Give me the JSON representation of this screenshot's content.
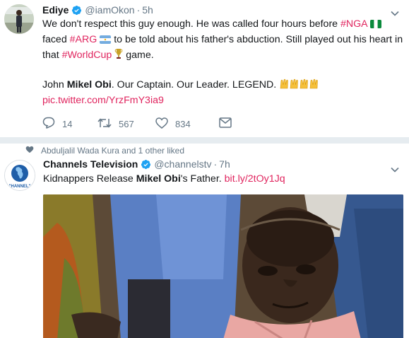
{
  "tweets": [
    {
      "name": "Ediye",
      "handle": "@iamOkon",
      "dot": "·",
      "time": "5h",
      "text": {
        "l1a": "We don't respect this guy enough. He was called four hours before ",
        "l1tag": "#NGA",
        "l2a": "faced ",
        "l2tag": "#ARG",
        "l2b": " to be told about his father's abduction. Still played out his heart in",
        "l3a": "that ",
        "l3tag": "#WorldCup",
        "l3b": " game.",
        "l4a": "John ",
        "l4bold": "Mikel Obi",
        "l4b": ". Our Captain. Our Leader. LEGEND.",
        "link": "pic.twitter.com/YrzFmY3ia9"
      },
      "stats": {
        "replies": "14",
        "retweets": "567",
        "likes": "834"
      }
    },
    {
      "social_context": "Abduljalil Wada Kura and 1 other liked",
      "name": "Channels Television",
      "handle": "@channelstv",
      "dot": "·",
      "time": "7h",
      "avatar_text": "\"HANNEL\"",
      "text": {
        "a": "Kidnappers Release ",
        "bold": "Mikel Obi",
        "b": "'s Father. ",
        "link": "bit.ly/2tOy1Jq"
      }
    }
  ],
  "colors": {
    "hashtag": "#e0245e",
    "verified": "#1da1f2",
    "muted": "#657786"
  },
  "icons": [
    "verified-icon",
    "chevron-down-icon",
    "reply-icon",
    "retweet-icon",
    "heart-icon",
    "message-icon",
    "raised-hands-emoji",
    "flag-icon",
    "trophy-emoji"
  ]
}
